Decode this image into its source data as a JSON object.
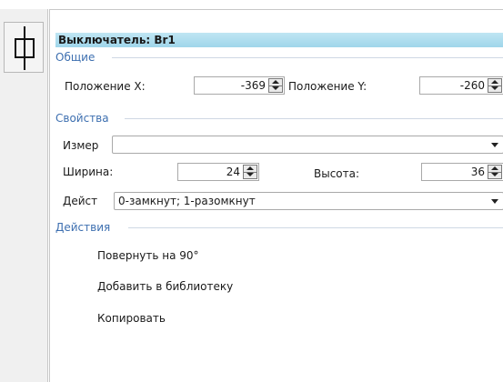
{
  "toolbar": {
    "switch_icon": "switch-symbol-icon"
  },
  "panel": {
    "title": "Выключатель: Br1",
    "general": {
      "heading": "Общие",
      "pos_x_label": "Положение X:",
      "pos_x_value": "-369",
      "pos_y_label": "Положение Y:",
      "pos_y_value": "-260"
    },
    "properties": {
      "heading": "Свойства",
      "measure_label": "Измер",
      "measure_value": "",
      "width_label": "Ширина:",
      "width_value": "24",
      "height_label": "Высота:",
      "height_value": "36",
      "action_label": "Дейст",
      "action_value": "0-замкнут; 1-разомкнут"
    },
    "actions": {
      "heading": "Действия",
      "items": [
        "Повернуть на 90°",
        "Добавить в библиотеку",
        "Копировать"
      ]
    }
  },
  "colors": {
    "title_bar": "#a8daec",
    "group_heading": "#3d6fb0"
  }
}
